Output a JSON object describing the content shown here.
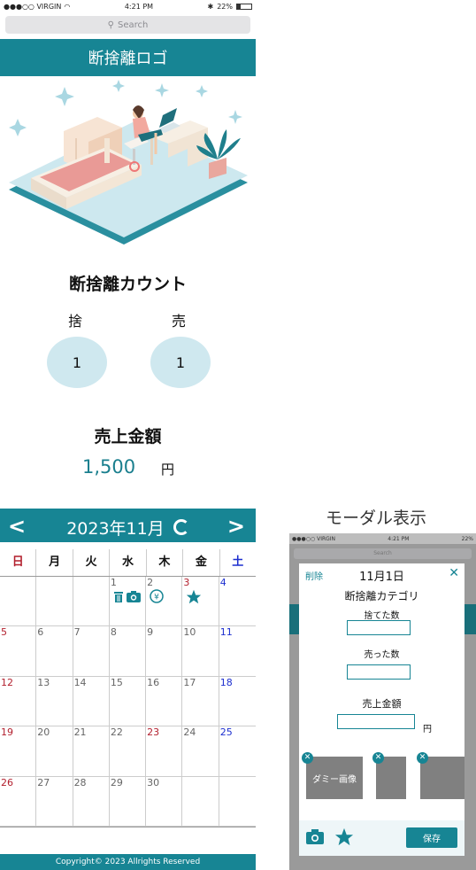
{
  "status": {
    "carrier": "●●●○○ VIRGIN",
    "time": "4:21 PM",
    "battery": "22%",
    "battery_level": 0.22
  },
  "search": {
    "placeholder": "Search"
  },
  "app": {
    "title": "断捨離ロゴ"
  },
  "count": {
    "title": "断捨離カウント",
    "discard_label": "捨",
    "discard_value": "1",
    "sell_label": "売",
    "sell_value": "1"
  },
  "sales": {
    "title": "売上金額",
    "value": "1,500",
    "unit": "円"
  },
  "calendar": {
    "month": "2023年11月",
    "weekdays": [
      "日",
      "月",
      "火",
      "水",
      "木",
      "金",
      "土"
    ],
    "weeks": [
      [
        "",
        "",
        "",
        "1",
        "2",
        "3",
        "4"
      ],
      [
        "5",
        "6",
        "7",
        "8",
        "9",
        "10",
        "11"
      ],
      [
        "12",
        "13",
        "14",
        "15",
        "16",
        "17",
        "18"
      ],
      [
        "19",
        "20",
        "21",
        "22",
        "23",
        "24",
        "25"
      ],
      [
        "26",
        "27",
        "28",
        "29",
        "30",
        "",
        ""
      ]
    ],
    "holidays": [
      "3",
      "23"
    ],
    "day_icons": {
      "1": [
        "trash-icon",
        "camera-icon"
      ],
      "2": [
        "yen-icon"
      ],
      "3": [
        "star-icon"
      ]
    }
  },
  "footer": {
    "text": "Copyright© 2023 Allrights Reserved"
  },
  "modal": {
    "caption": "モーダル表示",
    "delete_label": "削除",
    "date": "11月1日",
    "category_title": "断捨離カテゴリ",
    "discarded_label": "捨てた数",
    "sold_label": "売った数",
    "sales_label": "売上金額",
    "yen": "円",
    "dummy_image_label": "ダミー画像",
    "save_label": "保存"
  },
  "colors": {
    "teal": "#178594",
    "circle": "#cfe8ef",
    "sunday": "#b21f2d",
    "saturday": "#1d2fcf"
  }
}
